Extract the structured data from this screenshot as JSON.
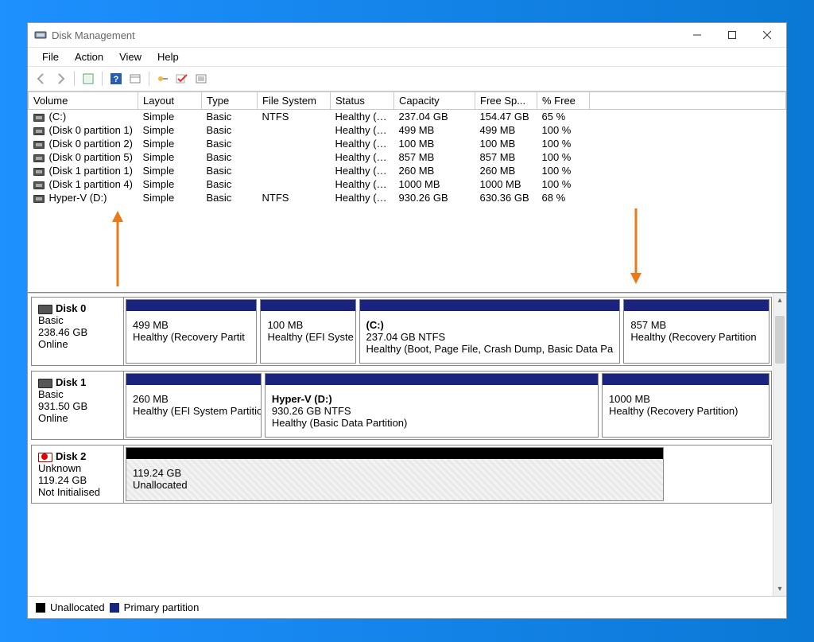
{
  "window": {
    "title": "Disk Management"
  },
  "menu": {
    "file": "File",
    "action": "Action",
    "view": "View",
    "help": "Help"
  },
  "columns": {
    "volume": "Volume",
    "layout": "Layout",
    "type": "Type",
    "fs": "File System",
    "status": "Status",
    "capacity": "Capacity",
    "free": "Free Sp...",
    "pct": "% Free"
  },
  "volumes": [
    {
      "name": "(C:)",
      "layout": "Simple",
      "type": "Basic",
      "fs": "NTFS",
      "status": "Healthy (B...",
      "capacity": "237.04 GB",
      "free": "154.47 GB",
      "pct": "65 %"
    },
    {
      "name": "(Disk 0 partition 1)",
      "layout": "Simple",
      "type": "Basic",
      "fs": "",
      "status": "Healthy (R...",
      "capacity": "499 MB",
      "free": "499 MB",
      "pct": "100 %"
    },
    {
      "name": "(Disk 0 partition 2)",
      "layout": "Simple",
      "type": "Basic",
      "fs": "",
      "status": "Healthy (E...",
      "capacity": "100 MB",
      "free": "100 MB",
      "pct": "100 %"
    },
    {
      "name": "(Disk 0 partition 5)",
      "layout": "Simple",
      "type": "Basic",
      "fs": "",
      "status": "Healthy (R...",
      "capacity": "857 MB",
      "free": "857 MB",
      "pct": "100 %"
    },
    {
      "name": "(Disk 1 partition 1)",
      "layout": "Simple",
      "type": "Basic",
      "fs": "",
      "status": "Healthy (E...",
      "capacity": "260 MB",
      "free": "260 MB",
      "pct": "100 %"
    },
    {
      "name": "(Disk 1 partition 4)",
      "layout": "Simple",
      "type": "Basic",
      "fs": "",
      "status": "Healthy (R...",
      "capacity": "1000 MB",
      "free": "1000 MB",
      "pct": "100 %"
    },
    {
      "name": "Hyper-V (D:)",
      "layout": "Simple",
      "type": "Basic",
      "fs": "NTFS",
      "status": "Healthy (B...",
      "capacity": "930.26 GB",
      "free": "630.36 GB",
      "pct": "68 %"
    }
  ],
  "disks": [
    {
      "name": "Disk 0",
      "type": "Basic",
      "size": "238.46 GB",
      "state": "Online",
      "err": false,
      "parts": [
        {
          "flex": 18,
          "l1": "",
          "l2": "499 MB",
          "l3": "Healthy (Recovery Partit"
        },
        {
          "flex": 13,
          "l1": "",
          "l2": "100 MB",
          "l3": "Healthy (EFI Syste"
        },
        {
          "flex": 36,
          "l1": "(C:)",
          "l2": "237.04 GB NTFS",
          "l3": "Healthy (Boot, Page File, Crash Dump, Basic Data Pa"
        },
        {
          "flex": 20,
          "l1": "",
          "l2": "857 MB",
          "l3": "Healthy (Recovery Partition"
        }
      ]
    },
    {
      "name": "Disk 1",
      "type": "Basic",
      "size": "931.50 GB",
      "state": "Online",
      "err": false,
      "parts": [
        {
          "flex": 21,
          "l1": "",
          "l2": "260 MB",
          "l3": "Healthy (EFI System Partitio"
        },
        {
          "flex": 52,
          "l1": "Hyper-V  (D:)",
          "l2": "930.26 GB NTFS",
          "l3": "Healthy (Basic Data Partition)"
        },
        {
          "flex": 26,
          "l1": "",
          "l2": "1000 MB",
          "l3": "Healthy (Recovery Partition)"
        }
      ]
    },
    {
      "name": "Disk 2",
      "type": "Unknown",
      "size": "119.24 GB",
      "state": "Not Initialised",
      "err": true,
      "parts": [
        {
          "flex": 84,
          "unalloc": true,
          "l1": "",
          "l2": "119.24 GB",
          "l3": "Unallocated"
        }
      ]
    }
  ],
  "legend": {
    "unalloc": "Unallocated",
    "primary": "Primary partition"
  }
}
